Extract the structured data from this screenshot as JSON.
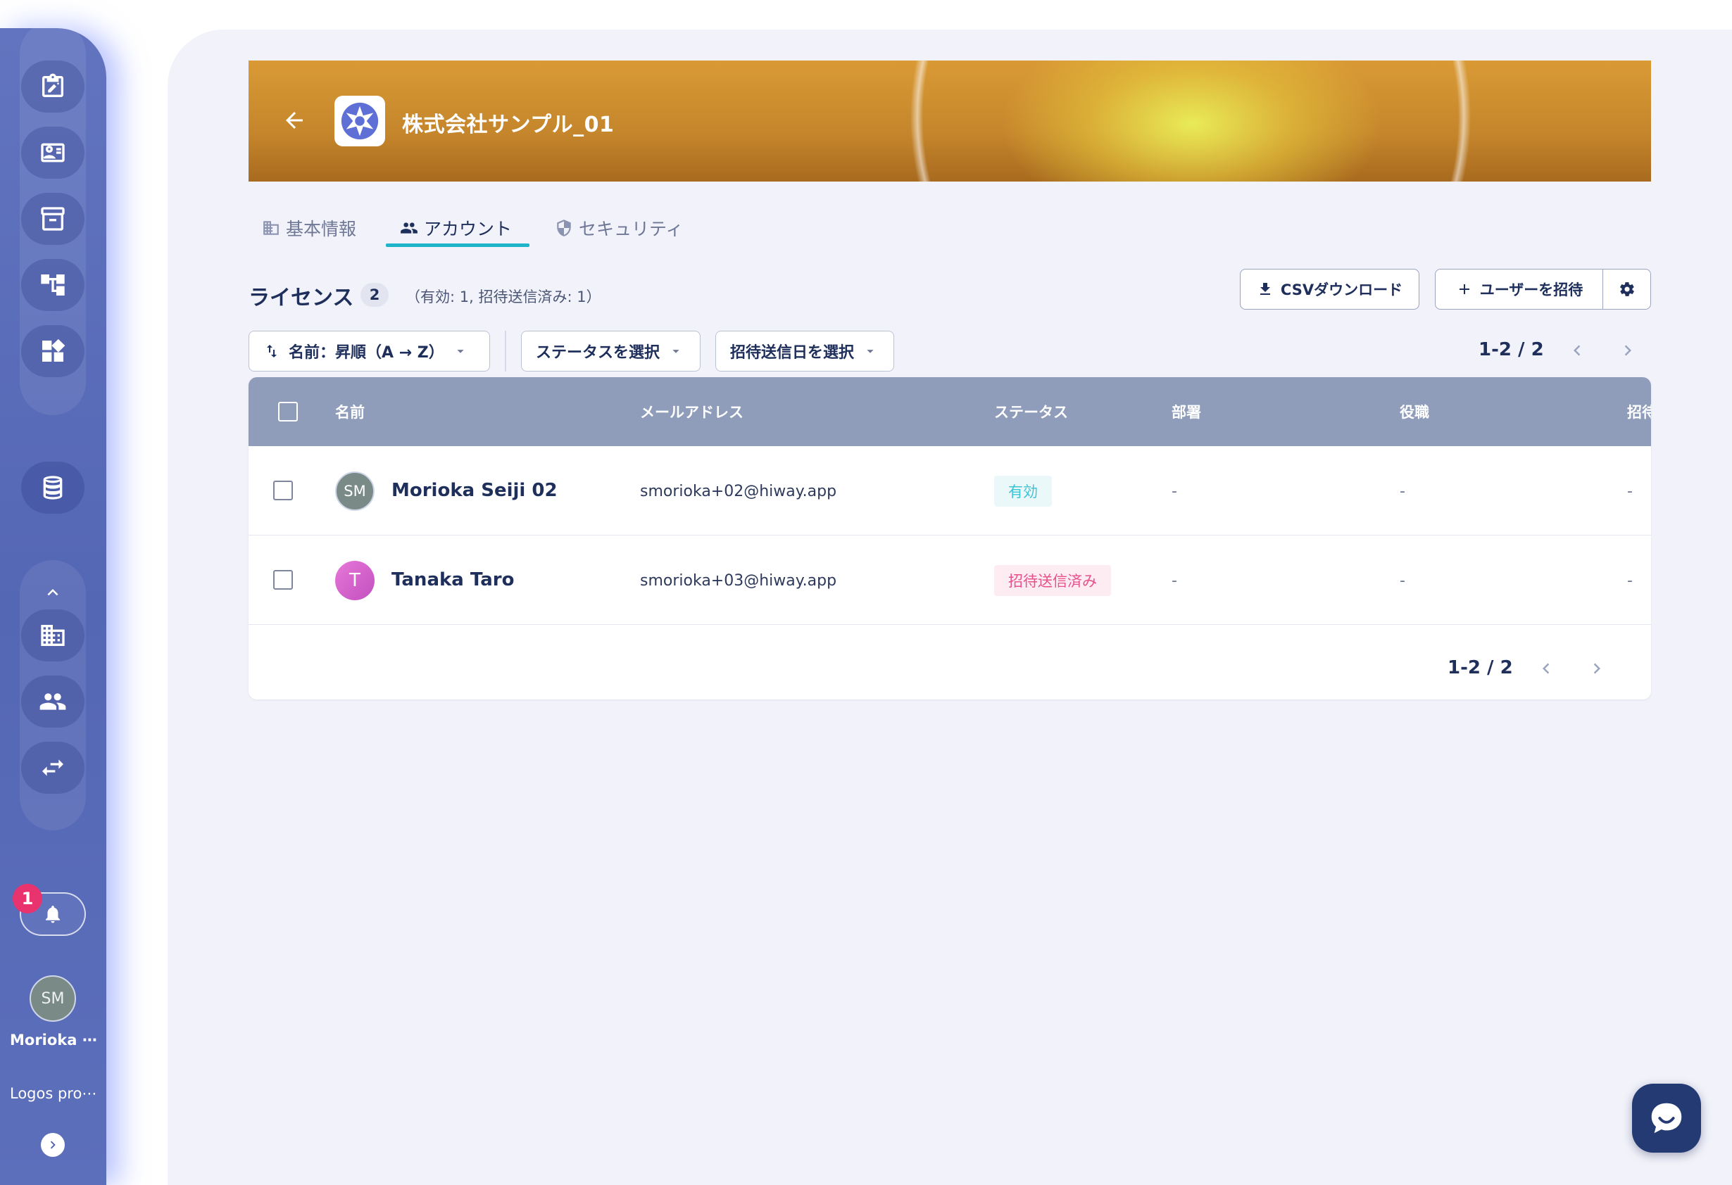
{
  "sidebar": {
    "notification_count": "1",
    "user_initials": "SM",
    "user_name": "Morioka ⋯",
    "org_name": "Logos pro⋯"
  },
  "banner": {
    "company_name": "株式会社サンプル_01"
  },
  "tabs": [
    {
      "label": "基本情報",
      "active": false
    },
    {
      "label": "アカウント",
      "active": true
    },
    {
      "label": "セキュリティ",
      "active": false
    }
  ],
  "license": {
    "title": "ライセンス",
    "count": "2",
    "summary": "（有効: 1, 招待送信済み: 1）"
  },
  "actions": {
    "csv_download": "CSVダウンロード",
    "invite_user": "ユーザーを招待"
  },
  "filters": {
    "sort": "名前：昇順（A → Z）",
    "status": "ステータスを選択",
    "invite_date": "招待送信日を選択"
  },
  "pagination": {
    "range_top": "1-2 / 2",
    "range_bottom": "1-2 / 2"
  },
  "table": {
    "columns": [
      "名前",
      "メールアドレス",
      "ステータス",
      "部署",
      "役職",
      "招待"
    ],
    "rows": [
      {
        "initials": "SM",
        "name": "Morioka Seiji 02",
        "email": "smorioka+02@hiway.app",
        "status": "有効",
        "department": "-",
        "position": "-",
        "invited": "-"
      },
      {
        "initials": "T",
        "name": "Tanaka Taro",
        "email": "smorioka+03@hiway.app",
        "status": "招待送信済み",
        "department": "-",
        "position": "-",
        "invited": "-"
      }
    ]
  },
  "colors": {
    "accent": "#1fb4c9",
    "navy": "#1f2f5c",
    "status_active_text": "#3cc3d4",
    "status_active_bg": "#eaf8fa",
    "status_invited_text": "#e8508a",
    "status_invited_bg": "#fdecf2"
  }
}
